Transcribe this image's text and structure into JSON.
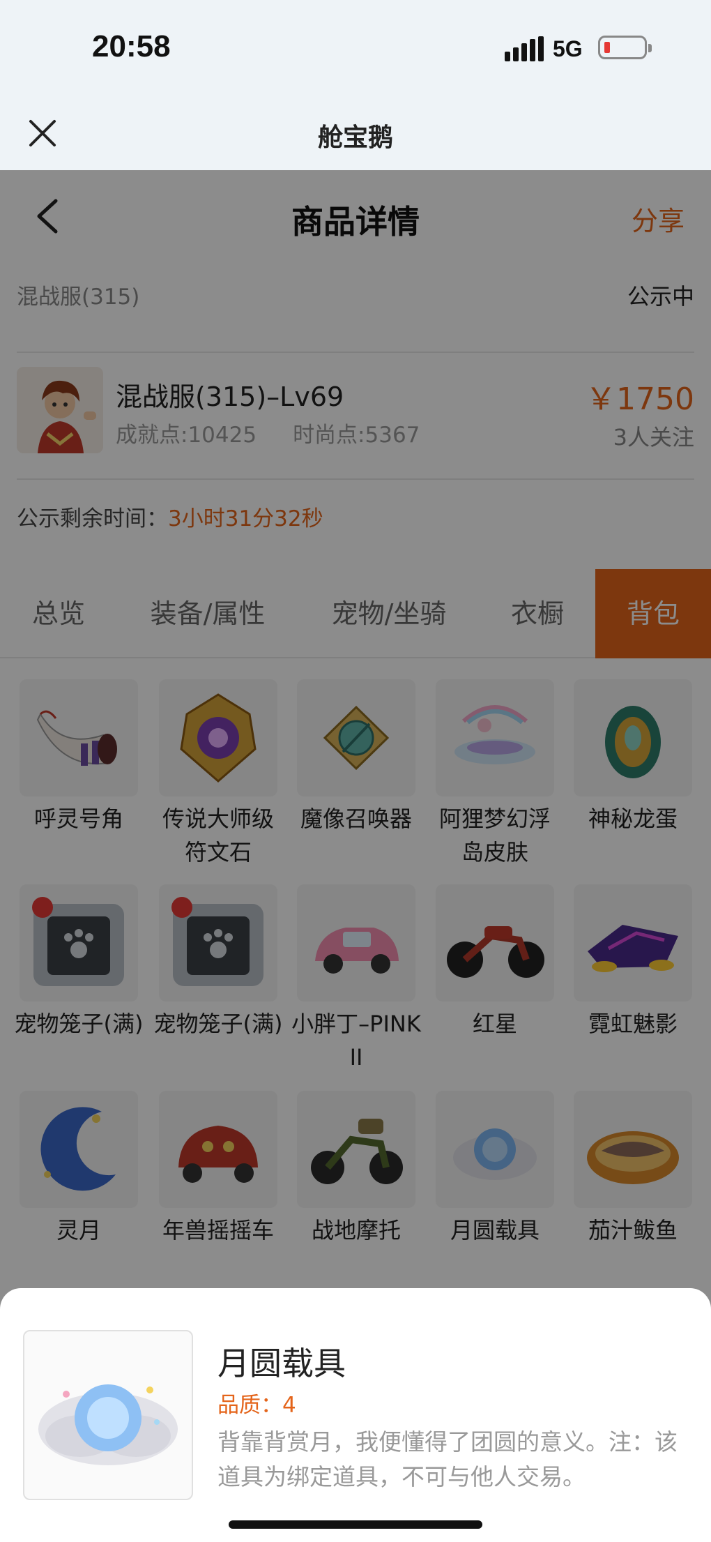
{
  "status_bar": {
    "time": "20:58",
    "network": "5G"
  },
  "app_header": {
    "title": "舱宝鹅"
  },
  "nav": {
    "title": "商品详情",
    "share": "分享"
  },
  "server": {
    "name": "混战服(315)",
    "status": "公示中"
  },
  "character": {
    "name": "混战服(315)–Lv69",
    "achievement": "成就点:10425",
    "fashion": "时尚点:5367",
    "price": "￥1750",
    "watchers": "3人关注"
  },
  "remaining": {
    "label": "公示剩余时间：",
    "time": "3小时31分32秒"
  },
  "tabs": [
    {
      "label": "总览"
    },
    {
      "label": "装备/属性"
    },
    {
      "label": "宠物/坐骑"
    },
    {
      "label": "衣橱"
    },
    {
      "label": "背包"
    }
  ],
  "items": [
    {
      "name": "呼灵号角"
    },
    {
      "name": "传说大师级符文石"
    },
    {
      "name": "魔像召唤器"
    },
    {
      "name": "阿狸梦幻浮岛皮肤"
    },
    {
      "name": "神秘龙蛋"
    },
    {
      "name": "宠物笼子(满)"
    },
    {
      "name": "宠物笼子(满)"
    },
    {
      "name": "小胖丁–PINK II"
    },
    {
      "name": "红星"
    },
    {
      "name": "霓虹魅影"
    },
    {
      "name": "灵月"
    },
    {
      "name": "年兽摇摇车"
    },
    {
      "name": "战地摩托"
    },
    {
      "name": "月圆载具"
    },
    {
      "name": "茄汁鲅鱼"
    }
  ],
  "detail_sheet": {
    "name": "月圆载具",
    "quality": "品质：4",
    "description": "背靠背赏月，我便懂得了团圆的意义。注：该道具为绑定道具，不可与他人交易。"
  },
  "colors": {
    "accent": "#e4641a",
    "header_bg": "#eef3f7"
  }
}
